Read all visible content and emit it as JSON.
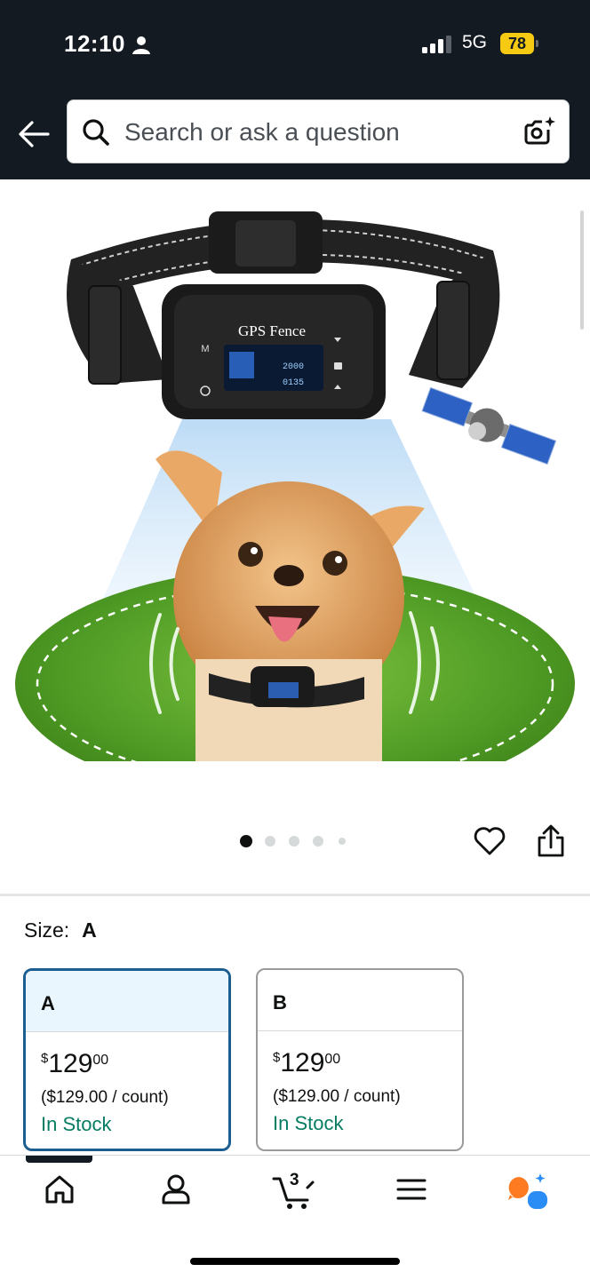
{
  "status_bar": {
    "time": "12:10",
    "network": "5G",
    "battery": "78"
  },
  "header": {
    "search_placeholder": "Search or ask a question",
    "icons": [
      "back-arrow-icon",
      "search-icon",
      "camera-search-icon"
    ]
  },
  "product_image": {
    "device_label": "GPS Fence",
    "screen_values": [
      "6",
      "8",
      "2000",
      "0135"
    ],
    "button_labels": [
      "M"
    ],
    "carousel": {
      "total": 5,
      "active": 1
    }
  },
  "size": {
    "label": "Size:",
    "selected": "A",
    "options": [
      {
        "name": "A",
        "price_symbol": "$",
        "price_whole": "129",
        "price_cents": "00",
        "unit_price": "($129.00 / count)",
        "stock": "In Stock",
        "selected": true
      },
      {
        "name": "B",
        "price_symbol": "$",
        "price_whole": "129",
        "price_cents": "00",
        "unit_price": "($129.00 / count)",
        "stock": "In Stock",
        "selected": false
      }
    ]
  },
  "tab_bar": {
    "cart_count": "3",
    "tabs": [
      "home-icon",
      "account-icon",
      "cart-icon",
      "menu-icon",
      "rufus-ai-icon"
    ]
  },
  "colors": {
    "header_bg": "#131a22",
    "battery": "#f6c913",
    "selected_border": "#1d5e91",
    "in_stock": "#067d62",
    "rufus_orange": "#ff7b22",
    "rufus_blue": "#2a8cf5"
  }
}
